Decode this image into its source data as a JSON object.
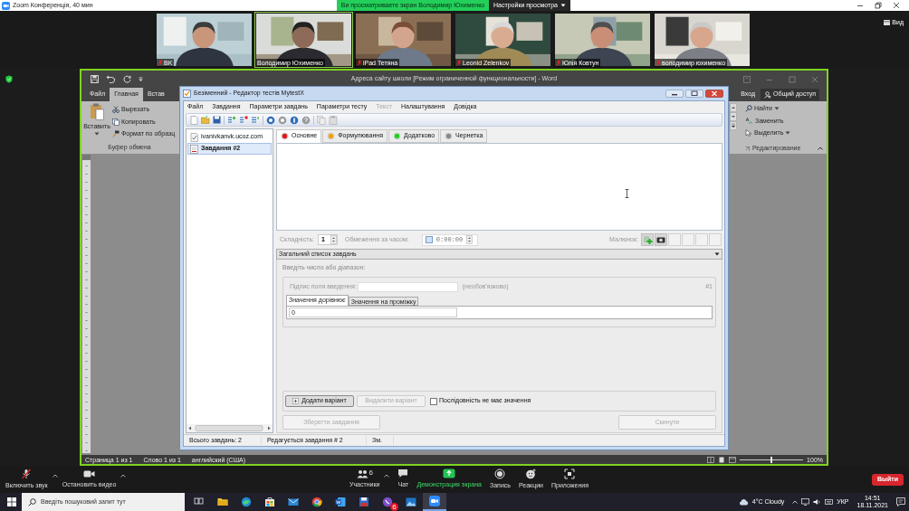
{
  "zoom": {
    "title": "Zoom Конференція, 40 мин",
    "share_banner": "Ви просматриваете экран Володимир Юхименко",
    "view_settings": "Настройки просмотра"
  },
  "participants": [
    {
      "name": "BK",
      "muted": true,
      "speaking": false
    },
    {
      "name": "Володимир Юхименко",
      "muted": false,
      "speaking": true
    },
    {
      "name": "iPad Тетяна",
      "muted": true,
      "speaking": false
    },
    {
      "name": "Leonid Zelenkov",
      "muted": true,
      "speaking": false
    },
    {
      "name": "Юлія Ковтун",
      "muted": true,
      "speaking": false
    },
    {
      "name": "володимир юхименко",
      "muted": true,
      "speaking": false
    }
  ],
  "view_button": "Вид",
  "word": {
    "title": "Адреса сайту школи [Режим ограниченной функциональности] - Word",
    "tabs": [
      {
        "label": "Файл",
        "selected": false
      },
      {
        "label": "Главная",
        "selected": true
      },
      {
        "label": "Встав",
        "selected": false
      }
    ],
    "sign_in": "Вход",
    "share": "Общий доступ",
    "clipboard": {
      "paste": "Вставить",
      "cut": "Вырезать",
      "copy": "Копировать",
      "format_painter": "Формат по образц",
      "group": "Буфер обмена"
    },
    "editing": {
      "find": "Найти",
      "replace": "Заменить",
      "select": "Выделить",
      "group": "Редактирование"
    },
    "status_bar": [
      "Страница 1 из 1",
      "Слово 1 из 1",
      "английский (США)"
    ],
    "zoom_slider": {
      "level": 0.5
    },
    "zoom_level": "100%"
  },
  "mytestx": {
    "title": "Безіменний - Редактор тестів MytestX",
    "menu": [
      {
        "label": "Файл",
        "disabled": false
      },
      {
        "label": "Завдання",
        "disabled": false
      },
      {
        "label": "Параметри завдань",
        "disabled": false
      },
      {
        "label": "Параметри тесту",
        "disabled": false
      },
      {
        "label": "Текст",
        "disabled": true
      },
      {
        "label": "Налаштування",
        "disabled": false
      },
      {
        "label": "Довідка",
        "disabled": false
      }
    ],
    "tree": [
      {
        "label": "ivanivkanvk.ucoz.com",
        "kind": "test",
        "selected": false
      },
      {
        "label": "Завдання #2",
        "kind": "task",
        "selected": true
      }
    ],
    "tabs": [
      {
        "label": "Основне",
        "color": "#e01818",
        "selected": true
      },
      {
        "label": "Формулювання",
        "color": "#f0a010",
        "selected": false
      },
      {
        "label": "Додатково",
        "color": "#22d022",
        "selected": false
      },
      {
        "label": "Чернетка",
        "color": "#8a8a8a",
        "selected": false
      }
    ],
    "difficulty_label": "Складність:",
    "difficulty": "1",
    "time_limit_label": "Обмеження за часом:",
    "time_limit_enabled": false,
    "time_limit": "0:00:00",
    "picture_label": "Малюнок:",
    "task_list": "Загальний список завдань",
    "prompt": "Введіть число або діапазон:",
    "field_caption_label": "Підпис поля введення:",
    "optional_note": "(необов'язково)",
    "variant_number": "#1",
    "value_tabs": [
      {
        "label": "Значення дорівнює",
        "selected": true
      },
      {
        "label": "Значення на проміжку",
        "selected": false
      }
    ],
    "value": "0",
    "variant_buttons": [
      {
        "label": "Додати варіант",
        "disabled": false
      },
      {
        "label": "Видалити варіант",
        "disabled": true
      }
    ],
    "order_checkbox": {
      "label": "Послідовність не має значення",
      "checked": false
    },
    "save_button": {
      "label": "Зберегти завдання",
      "disabled": true
    },
    "reset_button": {
      "label": "Скинути",
      "disabled": true
    },
    "status_bar": [
      "Всього завдань: 2",
      "Редагується завдання # 2",
      "Зм."
    ]
  },
  "meeting_toolbar": {
    "left": [
      {
        "kind": "audio",
        "label": "Включить звук"
      },
      {
        "kind": "video",
        "label": "Остановить видео"
      }
    ],
    "center": [
      {
        "kind": "participants",
        "label": "Участники",
        "count": "6"
      },
      {
        "kind": "chat",
        "label": "Чат"
      },
      {
        "kind": "share",
        "label": "Демонстрация экрана"
      },
      {
        "kind": "record",
        "label": "Запись"
      },
      {
        "kind": "reactions",
        "label": "Реакции"
      },
      {
        "kind": "apps",
        "label": "Приложения"
      }
    ],
    "leave": "Выйти"
  },
  "taskbar": {
    "search_placeholder": "Введіть пошуковий запит тут",
    "apps": [
      {
        "kind": "task-view",
        "active": false
      },
      {
        "kind": "explorer",
        "active": false
      },
      {
        "kind": "edge",
        "active": false
      },
      {
        "kind": "store",
        "active": false
      },
      {
        "kind": "mail",
        "active": false
      },
      {
        "kind": "chrome",
        "active": false
      },
      {
        "kind": "word",
        "active": false
      },
      {
        "kind": "floppy",
        "active": false
      },
      {
        "kind": "viber",
        "active": false,
        "badge": "6"
      },
      {
        "kind": "photos",
        "active": false
      },
      {
        "kind": "zoom",
        "active": true
      }
    ],
    "weather": "4°C Cloudy",
    "language": "УКР",
    "time": "14:51",
    "date": "18.11.2021"
  }
}
